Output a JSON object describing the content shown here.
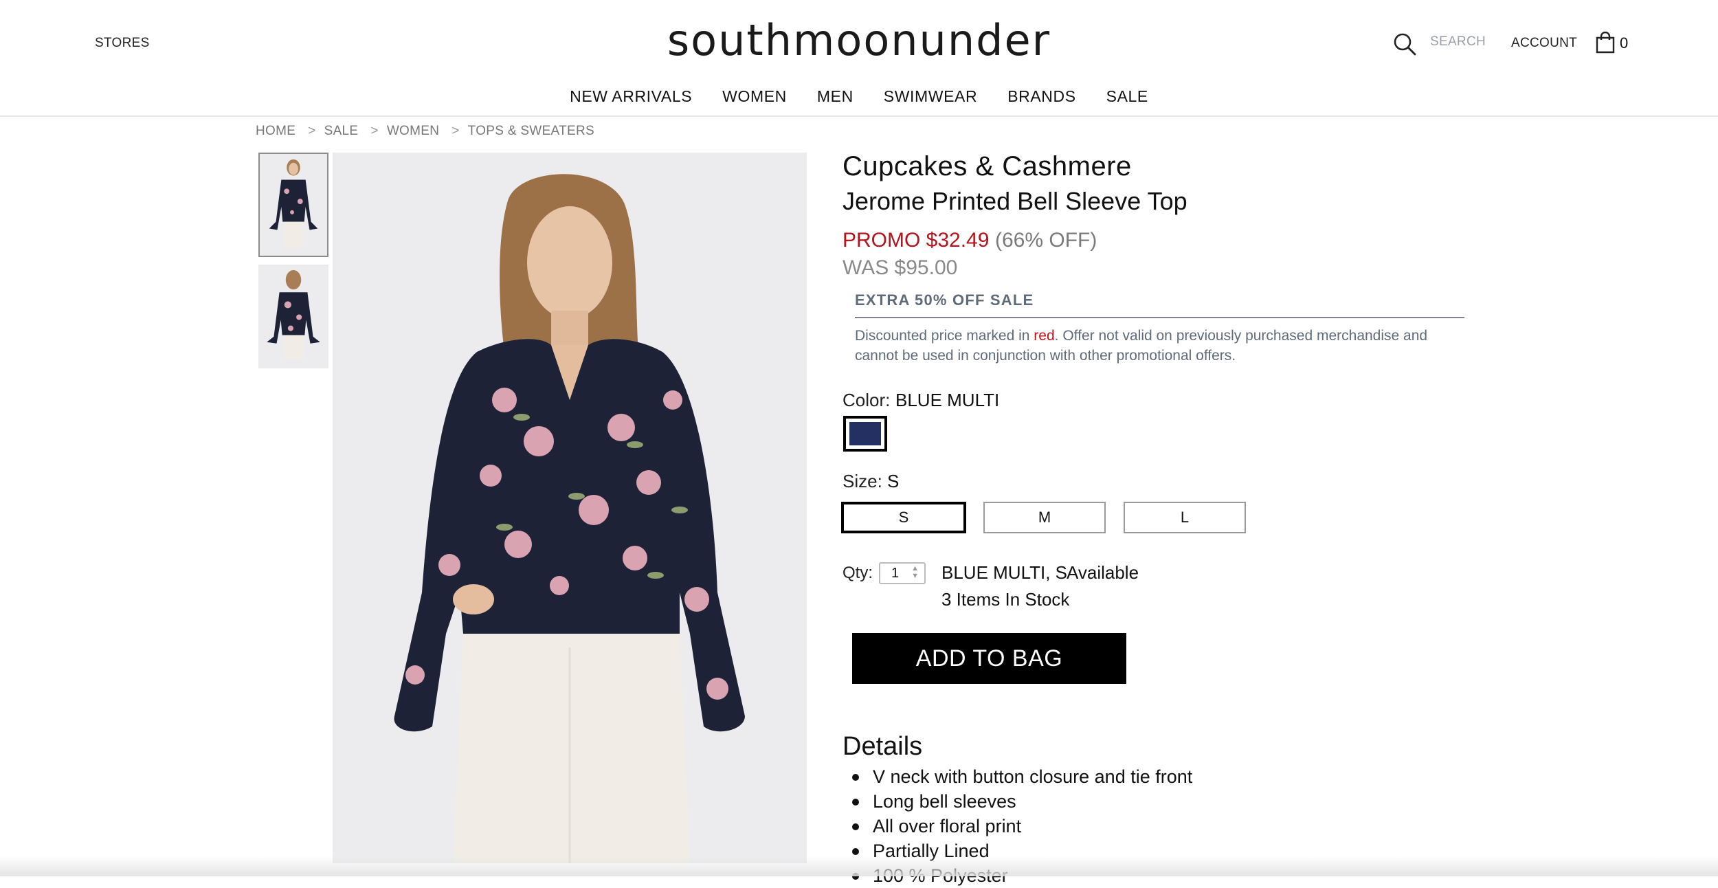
{
  "header": {
    "stores_label": "STORES",
    "logo_text": "southmoonunder",
    "search_placeholder": "SEARCH",
    "account_label": "ACCOUNT",
    "bag_count": "0"
  },
  "nav": {
    "items": [
      "NEW ARRIVALS",
      "WOMEN",
      "MEN",
      "SWIMWEAR",
      "BRANDS",
      "SALE"
    ]
  },
  "breadcrumb": {
    "items": [
      "HOME",
      "SALE",
      "WOMEN",
      "TOPS & SWEATERS"
    ],
    "separator": ">"
  },
  "product": {
    "brand": "Cupcakes & Cashmere",
    "name": "Jerome Printed Bell Sleeve Top",
    "promo_price": "PROMO $32.49",
    "discount": "(66% OFF)",
    "was_price": "WAS $95.00",
    "sale_title": "EXTRA 50% OFF SALE",
    "sale_note_before": "Discounted price marked in ",
    "sale_note_red": "red",
    "sale_note_after": ". Offer not valid on previously purchased merchandise and cannot be used in conjunction with other promotional offers.",
    "color_label": "Color:",
    "color_value": "BLUE MULTI",
    "swatch_color": "#233061",
    "size_label": "Size:",
    "size_value": "S",
    "sizes": [
      "S",
      "M",
      "L"
    ],
    "qty_label": "Qty:",
    "qty_value": "1",
    "availability_variant": "BLUE MULTI, S",
    "availability_status": "Available",
    "stock": "3 Items In Stock",
    "add_to_bag": "ADD TO BAG"
  },
  "details": {
    "title": "Details",
    "items": [
      "V neck with button closure and tie front",
      "Long bell sleeves",
      "All over floral print",
      "Partially Lined",
      "100 % Polyester"
    ]
  },
  "colors": {
    "promo_red": "#b5121b",
    "top_navy": "#1d2236",
    "skirt_white": "#f1ede6",
    "image_bg": "#ececee"
  }
}
